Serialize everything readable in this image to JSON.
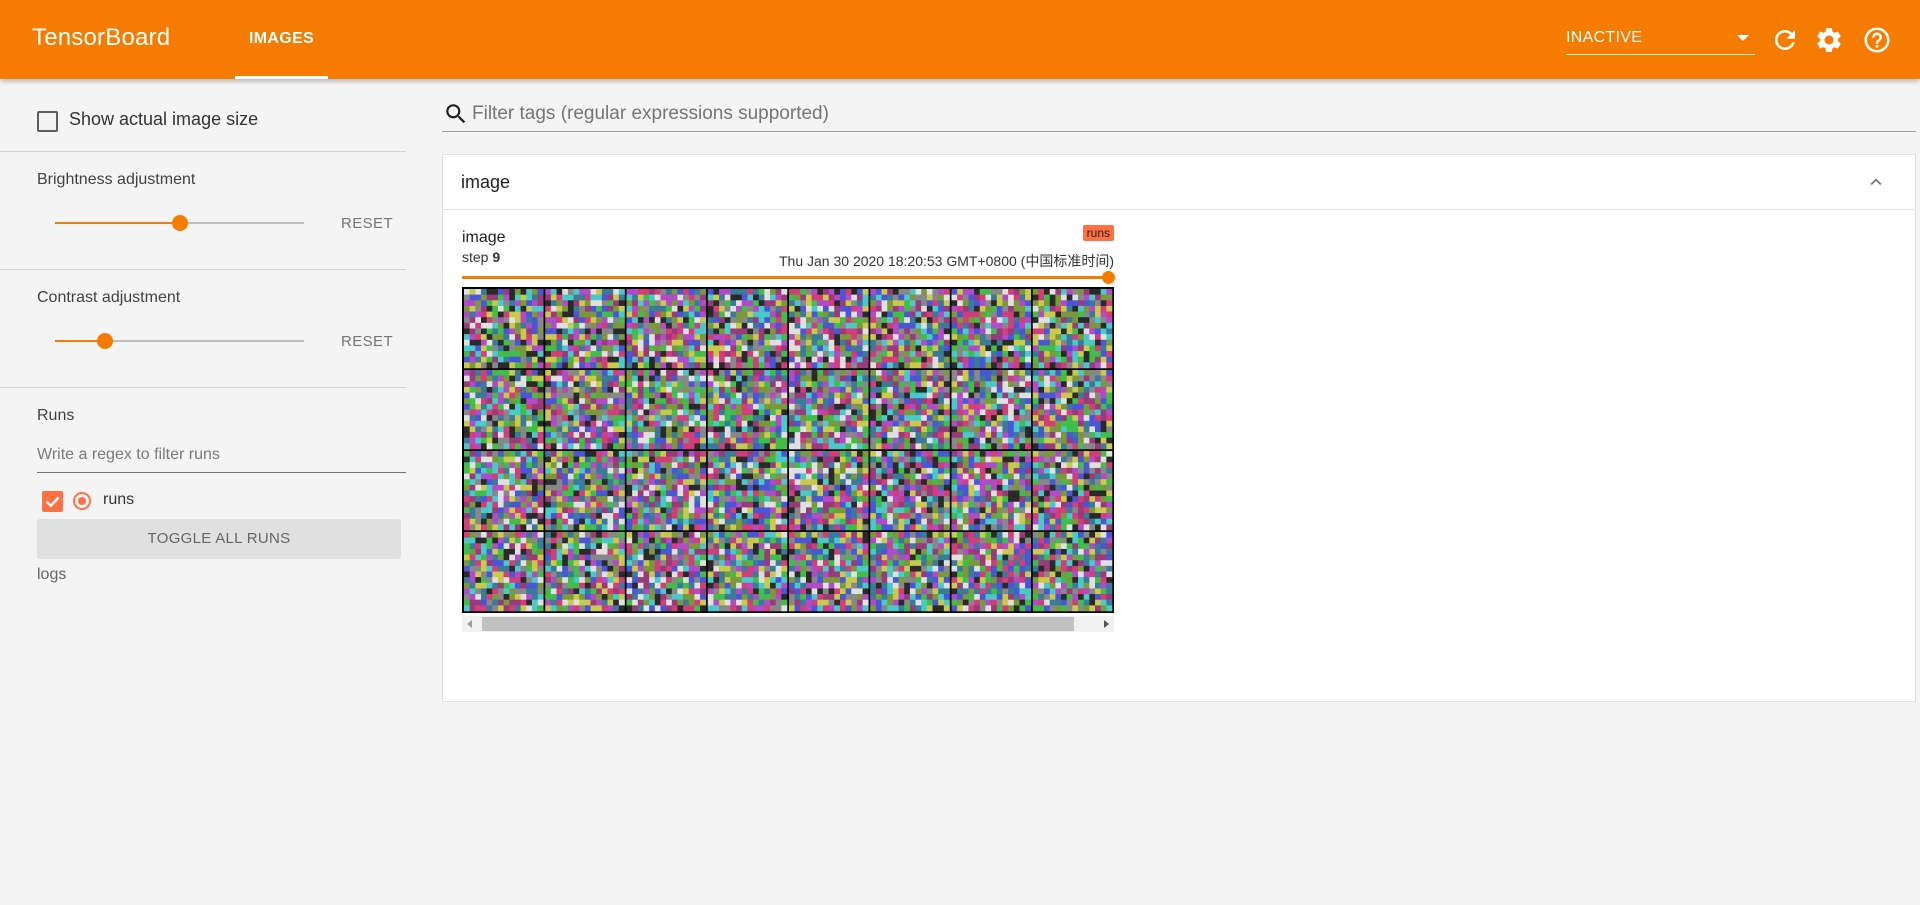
{
  "app": {
    "title": "TensorBoard",
    "tabs": [
      {
        "label": "IMAGES",
        "active": true
      }
    ],
    "status_select": {
      "value": "INACTIVE"
    },
    "icons": [
      "refresh-icon",
      "settings-icon",
      "help-icon"
    ],
    "accent_color": "#f57c00",
    "run_color": "#ff7043"
  },
  "sidebar": {
    "show_actual_size": {
      "label": "Show actual image size",
      "checked": false
    },
    "brightness": {
      "label": "Brightness adjustment",
      "reset_label": "RESET",
      "value": 0.5
    },
    "contrast": {
      "label": "Contrast adjustment",
      "reset_label": "RESET",
      "value": 0.2
    },
    "runs": {
      "title": "Runs",
      "filter_placeholder": "Write a regex to filter runs",
      "items": [
        {
          "name": "runs",
          "checked": true,
          "selected": true
        }
      ],
      "toggle_label": "TOGGLE ALL RUNS",
      "logdir": "logs"
    }
  },
  "main": {
    "filter_placeholder": "Filter tags (regular expressions supported)",
    "category": {
      "title": "image",
      "cards": [
        {
          "tag": "image",
          "step_label": "step",
          "step": "9",
          "run_badge": "runs",
          "timestamp": "Thu Jan 30 2020 18:20:53 GMT+0800 (中国标准时间)",
          "step_slider_value": 1.0,
          "grid": {
            "rows": 4,
            "cols": 8
          }
        }
      ]
    }
  }
}
